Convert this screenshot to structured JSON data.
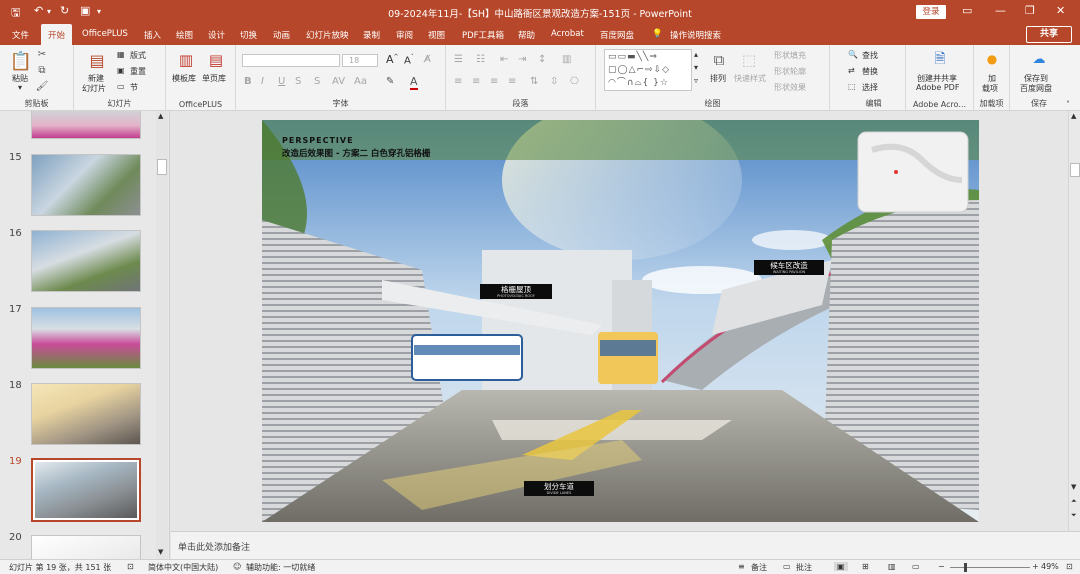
{
  "window": {
    "title": "09-2024年11月-【SH】中山路衙区景观改造方案-151页  -  PowerPoint",
    "login_label": "登录",
    "share_label": "共享"
  },
  "tabs": [
    {
      "label": "文件"
    },
    {
      "label": "开始",
      "active": true
    },
    {
      "label": "OfficePLUS"
    },
    {
      "label": "插入"
    },
    {
      "label": "绘图"
    },
    {
      "label": "设计"
    },
    {
      "label": "切换"
    },
    {
      "label": "动画"
    },
    {
      "label": "幻灯片放映"
    },
    {
      "label": "录制"
    },
    {
      "label": "审阅"
    },
    {
      "label": "视图"
    },
    {
      "label": "PDF工具箱"
    },
    {
      "label": "帮助"
    },
    {
      "label": "Acrobat"
    },
    {
      "label": "百度网盘"
    },
    {
      "label": "操作说明搜索"
    }
  ],
  "ribbon": {
    "clipboard": {
      "paste": "粘贴",
      "group": "剪贴板"
    },
    "slides": {
      "new_slide_1": "新建",
      "new_slide_2": "幻灯片",
      "layout": "版式",
      "reset": "重置",
      "section": "节",
      "group": "幻灯片"
    },
    "officeplus": {
      "template_lib": "模板库",
      "single_page_lib": "单页库",
      "group": "OfficePLUS"
    },
    "font": {
      "size": "18",
      "bold": "B",
      "italic": "I",
      "underline": "U",
      "strike": "S",
      "group": "字体"
    },
    "paragraph": {
      "group": "段落"
    },
    "drawing": {
      "arrange": "排列",
      "quick_styles": "快速样式",
      "shape_fill": "形状填充",
      "shape_outline": "形状轮廓",
      "shape_effect": "形状效果",
      "group": "绘图"
    },
    "editing": {
      "find": "查找",
      "replace": "替换",
      "select": "选择",
      "group": "编辑"
    },
    "adobe": {
      "create_share_1": "创建并共享",
      "create_share_2": "Adobe PDF",
      "group": "Adobe Acro..."
    },
    "addins": {
      "label_1": "加",
      "label_2": "载项",
      "group": "加载项"
    },
    "save": {
      "label_1": "保存到",
      "label_2": "百度网盘",
      "group": "保存"
    }
  },
  "thumbnails": [
    {
      "num": "15"
    },
    {
      "num": "16"
    },
    {
      "num": "17"
    },
    {
      "num": "18"
    },
    {
      "num": "19",
      "selected": true
    },
    {
      "num": "20"
    }
  ],
  "slide": {
    "heading_en": "PERSPECTIVE",
    "heading_cn": "改造后效果图 - 方案二 白色穿孔铝格栅",
    "callouts": [
      {
        "text": "格栅屋顶",
        "sub": "PHOTOVOLTAIC ROOF"
      },
      {
        "text": "候车区改造",
        "sub": "WAITING PAVILION"
      },
      {
        "text": "划分车道",
        "sub": "DIVIDE LANES"
      }
    ]
  },
  "notes": {
    "placeholder": "单击此处添加备注"
  },
  "status": {
    "slide_info": "幻灯片 第 19 张，共 151 张",
    "language": "简体中文(中国大陆)",
    "accessibility": "辅助功能: 一切就绪",
    "notes_btn": "备注",
    "comments_btn": "批注",
    "zoom": "49%"
  },
  "colors": {
    "accent": "#b7472a",
    "ribbon_bg": "#f3f3f3",
    "workspace": "#e6e6e6"
  }
}
